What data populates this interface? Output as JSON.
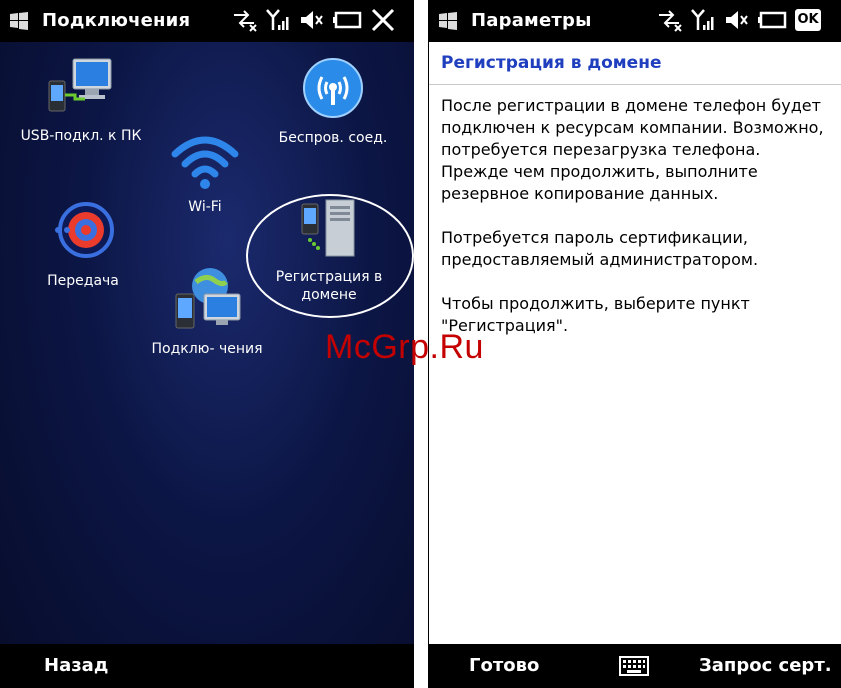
{
  "left_screen": {
    "title": "Подключения",
    "items": [
      {
        "label": "USB-подкл. к ПК"
      },
      {
        "label": "Wi-Fi"
      },
      {
        "label": "Беспров. соед."
      },
      {
        "label": "Передача"
      },
      {
        "label": "Регистрация в домене"
      },
      {
        "label": "Подклю- чения"
      }
    ],
    "softkey_left": "Назад"
  },
  "right_screen": {
    "title": "Параметры",
    "ok_label": "OK",
    "section_title": "Регистрация в домене",
    "paragraphs": [
      "После регистрации в домене телефон будет подключен к ресурсам компании. Возможно, потребуется перезагрузка телефона. Прежде чем продолжить, выполните резервное копирование данных.",
      "Потребуется пароль сертификации, предоставляемый администратором.",
      "Чтобы продолжить, выберите пункт \"Регистрация\"."
    ],
    "softkey_left": "Готово",
    "softkey_right": "Запрос серт."
  },
  "watermark": "McGrp.Ru",
  "colors": {
    "accent_title": "#1f3fbf",
    "bar": "#000000",
    "watermark": "#c40000"
  }
}
